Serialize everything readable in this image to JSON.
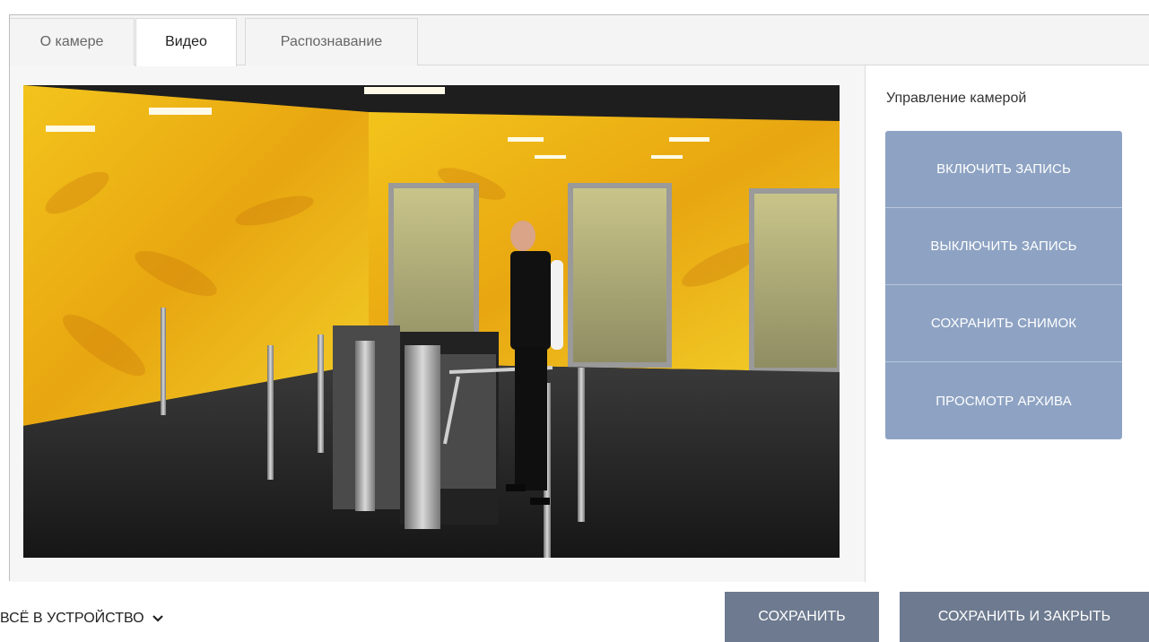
{
  "tabs": [
    {
      "label": "О камере"
    },
    {
      "label": "Видео"
    },
    {
      "label": "Распознавание"
    }
  ],
  "active_tab": "Видео",
  "camera_control": {
    "title": "Управление камерой",
    "buttons": [
      {
        "label": "ВКЛЮЧИТЬ ЗАПИСЬ"
      },
      {
        "label": "ВЫКЛЮЧИТЬ ЗАПИСЬ"
      },
      {
        "label": "СОХРАНИТЬ СНИМОК"
      },
      {
        "label": "ПРОСМОТР АРХИВА"
      }
    ]
  },
  "footer": {
    "dropdown_label": "ВСЁ В УСТРОЙСТВО",
    "save_label": "СОХРАНИТЬ",
    "save_close_label": "СОХРАНИТЬ И ЗАКРЫТЬ"
  },
  "icons": {
    "dropdown": "chevron-down-icon"
  },
  "colors": {
    "control_button": "#8ea3c3",
    "footer_button": "#6d7a8f"
  }
}
